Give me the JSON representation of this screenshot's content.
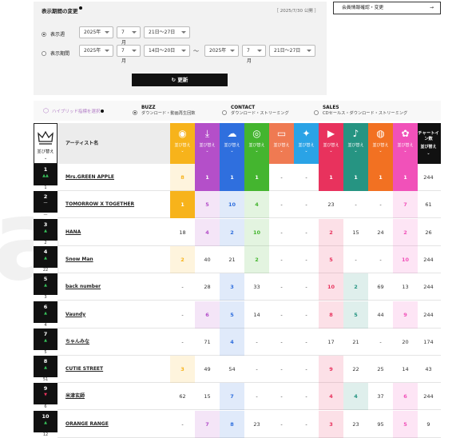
{
  "period_panel": {
    "title": "表示期間の変更",
    "published": "［ 2025/7/30 公開 ］",
    "weekly_label": "表示週",
    "range_label": "表示期間",
    "weekly": {
      "year": "2025年",
      "month": "7月",
      "week": "21日〜27日"
    },
    "range_from": {
      "year": "2025年",
      "month": "7月",
      "week": "14日〜20日"
    },
    "tilde": "〜",
    "range_to": {
      "year": "2025年",
      "month": "7月",
      "week": "21日〜27日"
    },
    "update_button": "↻ 更新"
  },
  "member_button": {
    "label": "会員情報確認・変更",
    "arrow": "→"
  },
  "modes": {
    "hybrid_label": "ハイブリッド指標を選択",
    "options": [
      {
        "title": "BUZZ",
        "desc": "ダウンロード・動画再生回数"
      },
      {
        "title": "CONTACT",
        "desc": "ダウンロード・ストリーミング"
      },
      {
        "title": "SALES",
        "desc": "CDセールス・ダウンロード・ストリーミング"
      }
    ]
  },
  "table": {
    "sort_label": "並び替え",
    "artist_header": "アーティスト名",
    "chart_in_header": "チャートイン数",
    "columns": [
      {
        "icon": "cd-icon",
        "glyph": "◉",
        "color": "#f7b31b",
        "label": "並び替え"
      },
      {
        "icon": "download-icon",
        "glyph": "⤓",
        "color": "#b44fc9",
        "label": "並び替え"
      },
      {
        "icon": "cloud-icon",
        "glyph": "☁",
        "color": "#2f6fde",
        "label": "並び替え"
      },
      {
        "icon": "podcast-icon",
        "glyph": "◎",
        "color": "#44b52f",
        "label": "並び替え"
      },
      {
        "icon": "message-icon",
        "glyph": "▭",
        "color": "#ef7a52",
        "label": "並び替え"
      },
      {
        "icon": "twitter-icon",
        "glyph": "✦",
        "color": "#2aa3e6",
        "label": "並び替え"
      },
      {
        "icon": "youtube-icon",
        "glyph": "▶",
        "color": "#e8325d",
        "label": "並び替え"
      },
      {
        "icon": "microphone-icon",
        "glyph": "♪",
        "color": "#269482",
        "label": "並び替え"
      },
      {
        "icon": "radio-icon",
        "glyph": "◍",
        "color": "#f27122",
        "label": "並び替え"
      },
      {
        "icon": "spiral-icon",
        "glyph": "✿",
        "color": "#f151b9",
        "label": "並び替え"
      }
    ],
    "rows": [
      {
        "rank": "1",
        "trend": "▲▲",
        "prev": "1",
        "artist": "Mrs.GREEN APPLE",
        "vals": [
          "8",
          "1",
          "1",
          "1",
          "-",
          "-",
          "1",
          "1",
          "1",
          "1"
        ],
        "chart_in": "244"
      },
      {
        "rank": "2",
        "trend": "—",
        "prev": "—",
        "artist": "TOMORROW X TOGETHER",
        "vals": [
          "1",
          "5",
          "10",
          "4",
          "-",
          "-",
          "23",
          "-",
          "-",
          "7"
        ],
        "chart_in": "61"
      },
      {
        "rank": "3",
        "trend": "▲",
        "prev": "2",
        "artist": "HANA",
        "vals": [
          "18",
          "4",
          "2",
          "10",
          "-",
          "-",
          "2",
          "15",
          "24",
          "2"
        ],
        "chart_in": "26"
      },
      {
        "rank": "4",
        "trend": "▲",
        "prev": "22",
        "artist": "Snow Man",
        "vals": [
          "2",
          "40",
          "21",
          "2",
          "-",
          "-",
          "5",
          "-",
          "-",
          "10"
        ],
        "chart_in": "244"
      },
      {
        "rank": "5",
        "trend": "▲",
        "prev": "3",
        "artist": "back number",
        "vals": [
          "-",
          "28",
          "3",
          "33",
          "-",
          "-",
          "10",
          "2",
          "69",
          "13"
        ],
        "chart_in": "244"
      },
      {
        "rank": "6",
        "trend": "▲",
        "prev": "4",
        "artist": "Vaundy",
        "vals": [
          "-",
          "6",
          "5",
          "14",
          "-",
          "-",
          "8",
          "5",
          "44",
          "9"
        ],
        "chart_in": "244"
      },
      {
        "rank": "7",
        "trend": "▲",
        "prev": "5",
        "artist": "ちゃんみな",
        "vals": [
          "-",
          "71",
          "4",
          "-",
          "-",
          "-",
          "17",
          "21",
          "-",
          "20"
        ],
        "chart_in": "174"
      },
      {
        "rank": "8",
        "trend": "▲",
        "prev": "51",
        "artist": "CUTIE STREET",
        "vals": [
          "3",
          "49",
          "54",
          "-",
          "-",
          "-",
          "9",
          "22",
          "25",
          "14"
        ],
        "chart_in": "43"
      },
      {
        "rank": "9",
        "trend": "▼",
        "prev": "6",
        "artist": "米津玄師",
        "vals": [
          "62",
          "15",
          "7",
          "-",
          "-",
          "-",
          "4",
          "4",
          "37",
          "6"
        ],
        "chart_in": "244"
      },
      {
        "rank": "10",
        "trend": "▲",
        "prev": "12",
        "artist": "ORANGE RANGE",
        "vals": [
          "-",
          "7",
          "8",
          "23",
          "-",
          "-",
          "3",
          "23",
          "95",
          "5"
        ],
        "chart_in": "9"
      }
    ]
  }
}
